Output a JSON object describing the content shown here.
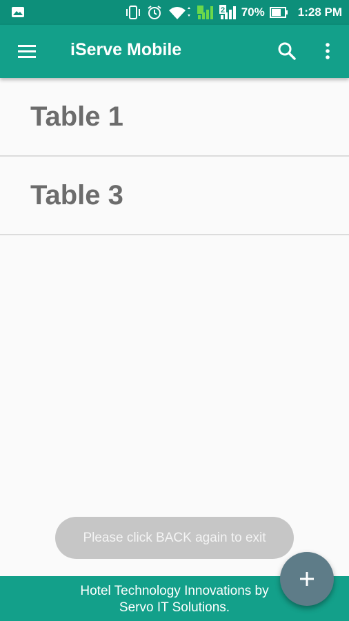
{
  "status_bar": {
    "battery_percent": "70%",
    "time": "1:28 PM",
    "sim2_label": "2",
    "icons": [
      "gallery-notification-icon",
      "vibrate-icon",
      "alarm-icon",
      "wifi-icon",
      "signal-sim1-icon",
      "signal-sim2-icon",
      "battery-icon"
    ]
  },
  "app_bar": {
    "title": "iServe Mobile",
    "icons": [
      "menu-icon",
      "search-icon",
      "more-vert-icon"
    ]
  },
  "tables": [
    {
      "label": "Table 1"
    },
    {
      "label": "Table 3"
    }
  ],
  "toast": {
    "message": "Please click BACK again to exit"
  },
  "footer": {
    "line1": "Hotel Technology Innovations by",
    "line2": "Servo IT Solutions."
  },
  "fab": {
    "icon": "plus-icon"
  },
  "colors": {
    "status_bar": "#0d8f7a",
    "primary": "#13a08a",
    "fab": "#5e7c88",
    "toast": "#c6c6c6",
    "row_text": "#6c6c6c"
  }
}
